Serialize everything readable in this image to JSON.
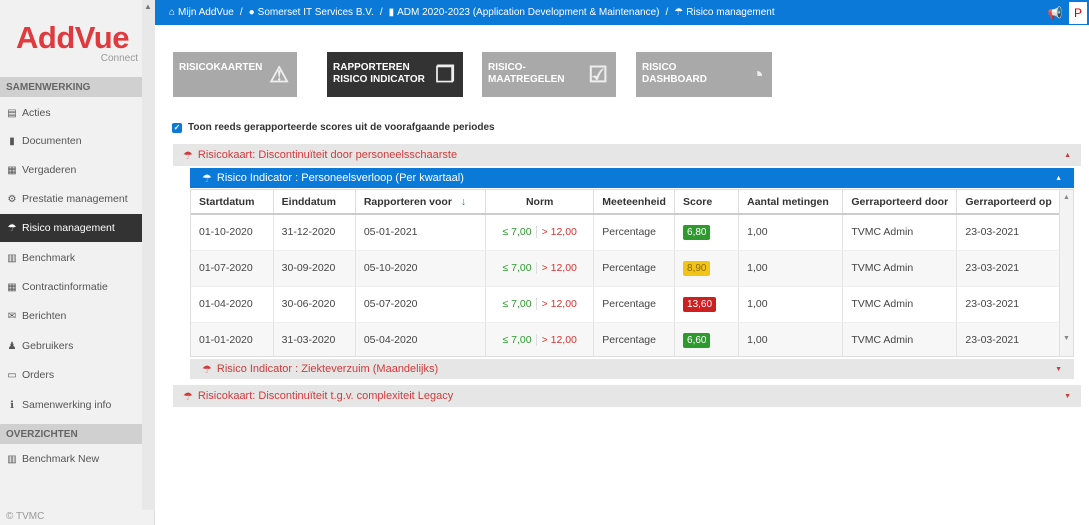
{
  "logo": {
    "main": "AddVue",
    "sub": "Connect"
  },
  "sidebar": {
    "sections": [
      {
        "title": "SAMENWERKING"
      },
      {
        "title": "OVERZICHTEN"
      }
    ],
    "items": [
      {
        "label": "Acties",
        "icon": "table-icon"
      },
      {
        "label": "Documenten",
        "icon": "file-icon"
      },
      {
        "label": "Vergaderen",
        "icon": "calendar-icon"
      },
      {
        "label": "Prestatie management",
        "icon": "gears-icon"
      },
      {
        "label": "Risico management",
        "icon": "umbrella-icon",
        "active": true
      },
      {
        "label": "Benchmark",
        "icon": "bar-chart-icon"
      },
      {
        "label": "Contractinformatie",
        "icon": "grid-icon"
      },
      {
        "label": "Berichten",
        "icon": "envelope-icon"
      },
      {
        "label": "Gebruikers",
        "icon": "users-icon"
      },
      {
        "label": "Orders",
        "icon": "document-icon"
      },
      {
        "label": "Samenwerking info",
        "icon": "info-icon"
      },
      {
        "label": "Benchmark New",
        "icon": "bar-chart-icon"
      }
    ],
    "footer": "© TVMC"
  },
  "breadcrumb": {
    "items": [
      "Mijn AddVue",
      "Somerset IT Services B.V.",
      "ADM 2020-2023 (Application Development & Maintenance)",
      "Risico management"
    ],
    "separator": "/"
  },
  "tiles": [
    {
      "line1": "RISICOKAARTEN",
      "line2": "",
      "icon": "warning-icon"
    },
    {
      "line1": "RAPPORTEREN",
      "line2": "RISICO INDICATOR",
      "icon": "copy-icon",
      "active": true
    },
    {
      "line1": "RISICO-",
      "line2": "MAATREGELEN",
      "icon": "checkbox-icon"
    },
    {
      "line1": "RISICO",
      "line2": "DASHBOARD",
      "icon": "dashboard-icon"
    }
  ],
  "checkbox_label": "Toon reeds gerapporteerde scores uit de voorafgaande periodes",
  "riskcards": [
    {
      "label": "Risicokaart: Discontinuïteit door personeelsschaarste"
    },
    {
      "label": "Risicokaart: Discontinuïteit t.g.v. complexiteit Legacy"
    }
  ],
  "indicators": [
    {
      "label": "Risico Indicator : Personeelsverloop (Per kwartaal)"
    },
    {
      "label": "Risico Indicator : Ziekteverzuim (Maandelijks)"
    }
  ],
  "table": {
    "headers": [
      "Startdatum",
      "Einddatum",
      "Rapporteren voor",
      "Norm",
      "Meeteenheid",
      "Score",
      "Aantal metingen",
      "Gerraporteerd door",
      "Gerraporteerd op"
    ],
    "sort_icon": "↓",
    "rows": [
      {
        "start": "01-10-2020",
        "end": "31-12-2020",
        "report": "05-01-2021",
        "norm_le": "≤ 7,00",
        "norm_gt": "> 12,00",
        "unit": "Percentage",
        "score": "6,80",
        "score_color": "#2e9a2e",
        "count": "1,00",
        "by": "TVMC Admin",
        "on": "23-03-2021"
      },
      {
        "start": "01-07-2020",
        "end": "30-09-2020",
        "report": "05-10-2020",
        "norm_le": "≤ 7,00",
        "norm_gt": "> 12,00",
        "unit": "Percentage",
        "score": "8,90",
        "score_color": "#f2c418",
        "count": "1,00",
        "by": "TVMC Admin",
        "on": "23-03-2021"
      },
      {
        "start": "01-04-2020",
        "end": "30-06-2020",
        "report": "05-07-2020",
        "norm_le": "≤ 7,00",
        "norm_gt": "> 12,00",
        "unit": "Percentage",
        "score": "13,60",
        "score_color": "#cc1f1f",
        "count": "1,00",
        "by": "TVMC Admin",
        "on": "23-03-2021"
      },
      {
        "start": "01-01-2020",
        "end": "31-03-2020",
        "report": "05-04-2020",
        "norm_le": "≤ 7,00",
        "norm_gt": "> 12,00",
        "unit": "Percentage",
        "score": "6,60",
        "score_color": "#2e9a2e",
        "count": "1,00",
        "by": "TVMC Admin",
        "on": "23-03-2021"
      }
    ]
  },
  "colors": {
    "accent": "#0b79d8",
    "brand": "#e0393e",
    "risk_text": "#d23a3a"
  }
}
